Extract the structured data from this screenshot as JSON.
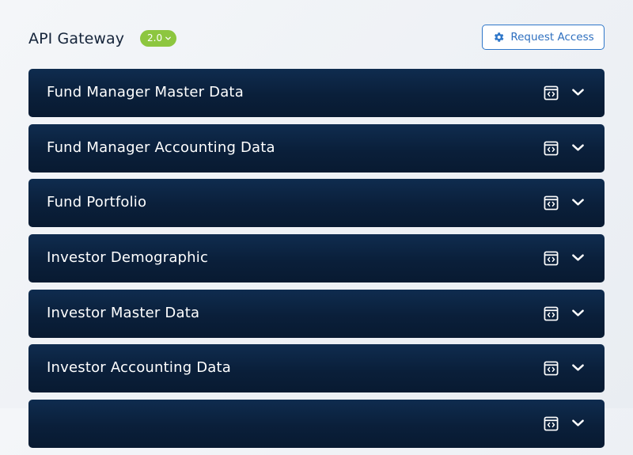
{
  "header": {
    "title": "API Gateway",
    "version": "2.0",
    "request_access_label": "Request Access"
  },
  "colors": {
    "row_background": "#0b223f",
    "badge_green": "#8dc63f",
    "accent_blue": "#2f77c9",
    "title_text": "#15243a"
  },
  "icons": {
    "version_dropdown": "chevron-down-icon",
    "request_access": "gear-icon",
    "row_api_spec": "code-window-icon",
    "row_expand": "chevron-down-icon"
  },
  "api_list": [
    {
      "label": "Fund Manager Master Data"
    },
    {
      "label": "Fund Manager Accounting Data"
    },
    {
      "label": "Fund Portfolio"
    },
    {
      "label": "Investor Demographic"
    },
    {
      "label": "Investor Master Data"
    },
    {
      "label": "Investor Accounting Data"
    },
    {
      "label": ""
    }
  ]
}
